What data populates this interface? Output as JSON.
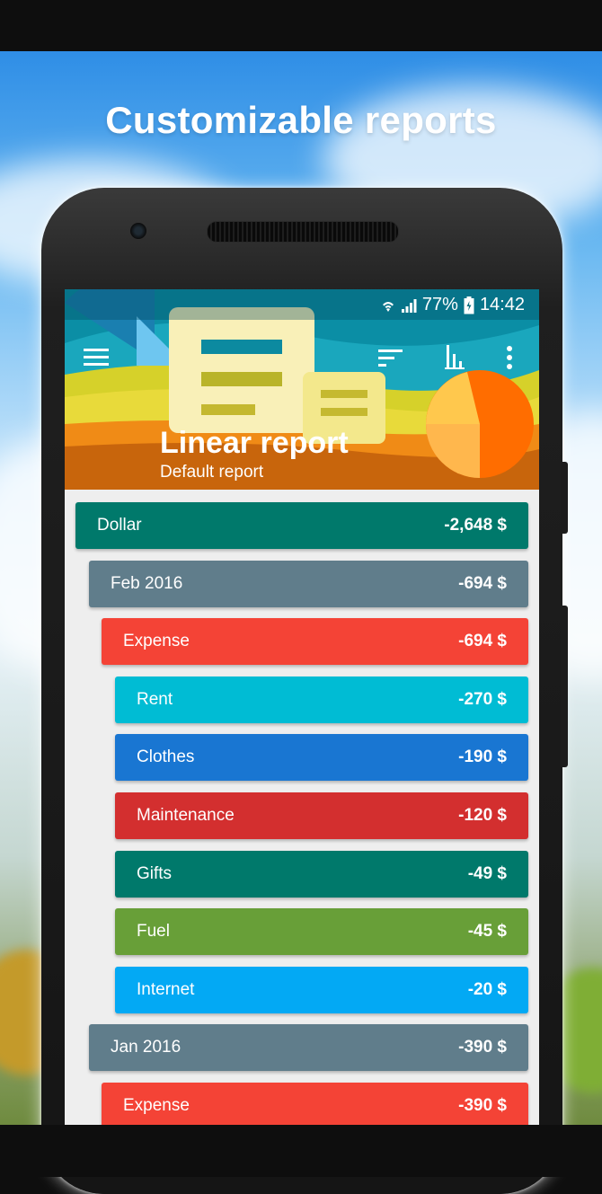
{
  "promo": {
    "headline": "Customizable reports"
  },
  "status_bar": {
    "battery": "77%",
    "time": "14:42",
    "icons": [
      "wifi-icon",
      "signal-icon",
      "battery-icon"
    ]
  },
  "toolbar": {
    "icons": [
      "menu-icon",
      "sort-icon",
      "chart-icon",
      "more-vert-icon"
    ]
  },
  "report": {
    "title": "Linear report",
    "subtitle": "Default report"
  },
  "rows": [
    {
      "label": "Dollar",
      "amount": "-2,648 $",
      "level": 0,
      "color": "#00796b"
    },
    {
      "label": "Feb 2016",
      "amount": "-694 $",
      "level": 1,
      "color": "#607d8b"
    },
    {
      "label": "Expense",
      "amount": "-694 $",
      "level": 2,
      "color": "#f44336"
    },
    {
      "label": "Rent",
      "amount": "-270 $",
      "level": 3,
      "color": "#00bcd4"
    },
    {
      "label": "Clothes",
      "amount": "-190 $",
      "level": 3,
      "color": "#1976d2"
    },
    {
      "label": "Maintenance",
      "amount": "-120 $",
      "level": 3,
      "color": "#d32f2f"
    },
    {
      "label": "Gifts",
      "amount": "-49 $",
      "level": 3,
      "color": "#00796b"
    },
    {
      "label": "Fuel",
      "amount": "-45 $",
      "level": 3,
      "color": "#689f38"
    },
    {
      "label": "Internet",
      "amount": "-20 $",
      "level": 3,
      "color": "#03a9f4"
    },
    {
      "label": "Jan 2016",
      "amount": "-390 $",
      "level": 1,
      "color": "#607d8b"
    },
    {
      "label": "Expense",
      "amount": "-390 $",
      "level": 2,
      "color": "#f44336"
    }
  ]
}
